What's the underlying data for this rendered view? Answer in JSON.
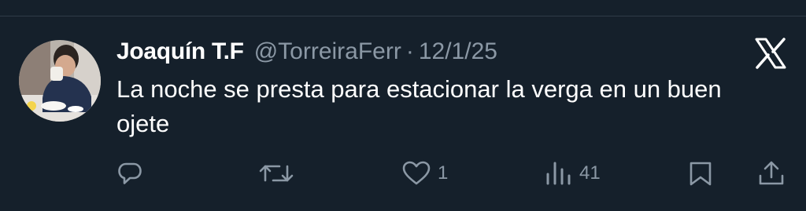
{
  "tweet": {
    "author_name": "Joaquín T.F",
    "handle": "@TorreiraFerr",
    "separator": "·",
    "date": "12/1/25",
    "text": "La noche se presta para estacionar la verga en un buen ojete",
    "avatar_icon": "profile-photo",
    "platform_icon": "x-logo-icon"
  },
  "actions": {
    "reply": {
      "icon": "reply-icon",
      "count": ""
    },
    "retweet": {
      "icon": "retweet-icon",
      "count": ""
    },
    "like": {
      "icon": "heart-icon",
      "count": "1"
    },
    "views": {
      "icon": "views-icon",
      "count": "41"
    },
    "bookmark": {
      "icon": "bookmark-icon",
      "count": ""
    },
    "share": {
      "icon": "share-icon",
      "count": ""
    }
  },
  "colors": {
    "background": "#15202b",
    "primary_text": "#ffffff",
    "secondary_text": "#8b98a5",
    "divider": "#2f3b47"
  }
}
